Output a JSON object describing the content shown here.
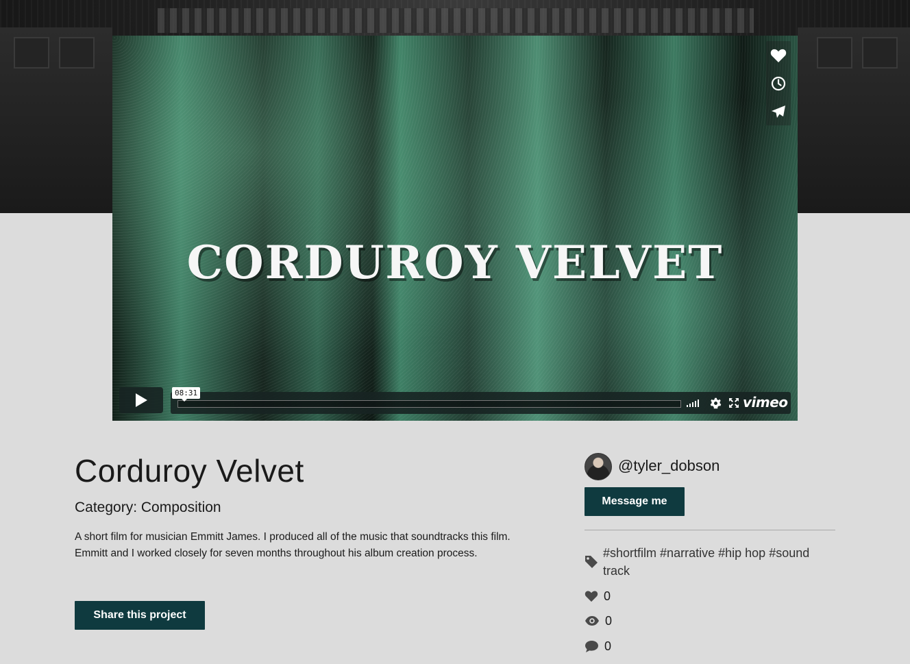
{
  "video": {
    "title_overlay": "CORDUROY VELVET",
    "timecode": "08:31",
    "player_brand": "vimeo",
    "side_actions": [
      "heart-icon",
      "clock-icon",
      "paper-plane-icon"
    ]
  },
  "project": {
    "title": "Corduroy Velvet",
    "category": "Category: Composition",
    "description": "A short film for musician Emmitt James. I produced all of the music that soundtracks this film. Emmitt and I worked closely for seven months throughout his album creation process.",
    "share_label": "Share this project"
  },
  "author": {
    "username": "@tyler_dobson",
    "message_label": "Message me"
  },
  "tags": [
    "#shortfilm",
    "#narrative",
    "#hip hop",
    "#sound track"
  ],
  "stats": {
    "likes": "0",
    "views": "0",
    "comments": "0"
  },
  "colors": {
    "accent_button": "#0f3a3f",
    "page_background": "#dcdcdc",
    "player_bar": "#172322"
  }
}
